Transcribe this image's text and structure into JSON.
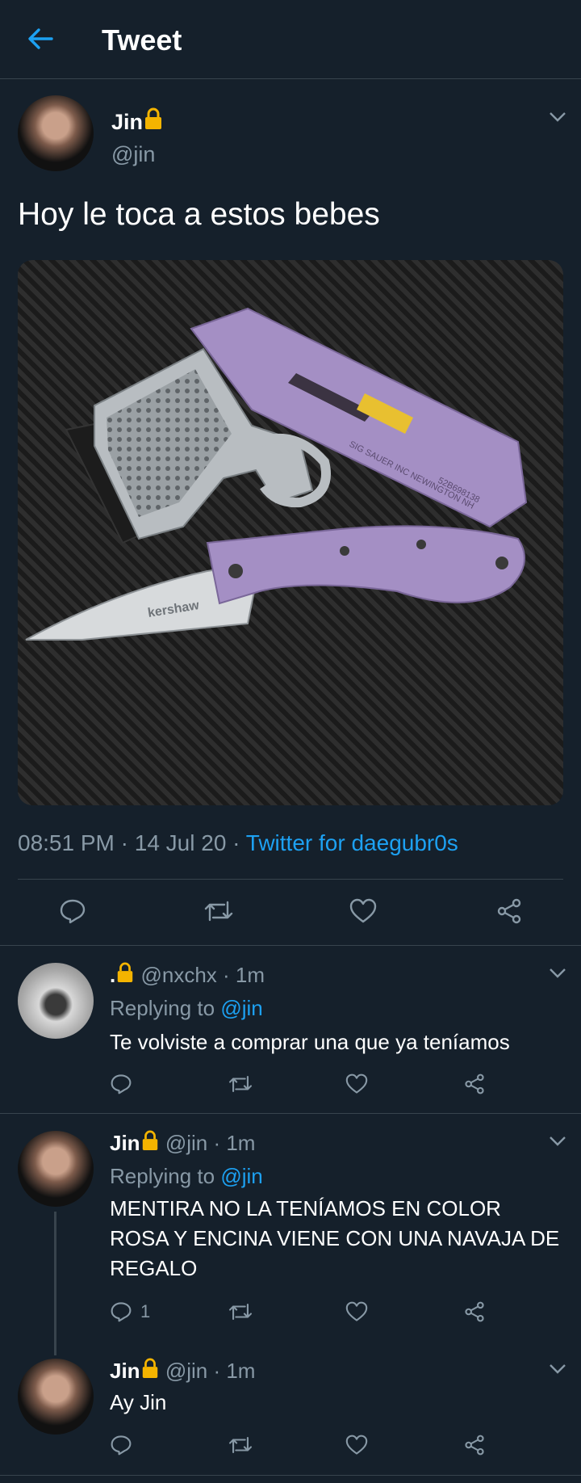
{
  "header": {
    "title": "Tweet"
  },
  "main_tweet": {
    "name": "Jin",
    "handle": "@jin",
    "text": "Hoy le toca a estos bebes",
    "time": "08:51 PM",
    "date": "14 Jul 20",
    "source": "Twitter for daegubr0s",
    "media_labels": {
      "brand": "kershaw",
      "slide": "SIG SAUER INC NEWINGTON NH",
      "serial": "52B698138"
    }
  },
  "replies": [
    {
      "name": ".",
      "handle": "@nxchx",
      "time": "1m",
      "replying_label": "Replying to",
      "replying_to": "@jin",
      "text": "Te volviste a comprar una que ya teníamos",
      "reply_count": ""
    },
    {
      "name": "Jin",
      "handle": "@jin",
      "time": "1m",
      "replying_label": "Replying to",
      "replying_to": "@jin",
      "text": "MENTIRA NO LA TENÍAMOS EN COLOR ROSA Y ENCINA VIENE CON UNA NAVAJA DE REGALO",
      "reply_count": "1"
    },
    {
      "name": "Jin",
      "handle": "@jin",
      "time": "1m",
      "text": "Ay Jin",
      "reply_count": ""
    }
  ],
  "colors": {
    "background": "#15202b",
    "accent": "#1da1f2",
    "muted": "#8899a6",
    "border": "#38444d",
    "lock": "#f4b400"
  },
  "icons": [
    "back-arrow-icon",
    "lock-icon",
    "chevron-down-icon",
    "reply-icon",
    "retweet-icon",
    "like-icon",
    "share-icon"
  ]
}
